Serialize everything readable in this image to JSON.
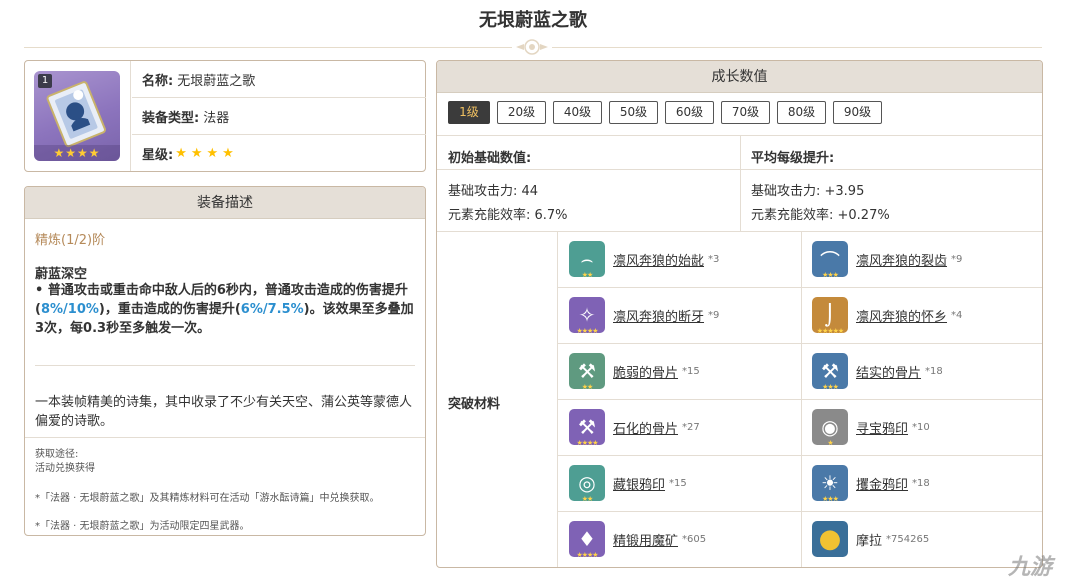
{
  "title": "无垠蔚蓝之歌",
  "info": {
    "level_badge": "1",
    "name_key": "名称:",
    "name_val": "无垠蔚蓝之歌",
    "type_key": "装备类型:",
    "type_val": "法器",
    "rarity_key": "星级:",
    "rarity_stars": "★★★★",
    "rarity": 4
  },
  "desc": {
    "header": "装备描述",
    "refine": "精炼(1/2)阶",
    "skill_name": "蔚蓝深空",
    "skill_text_1": "•  普通攻击或重击命中敌人后的6秒内，普通攻击造成的伤害提升(",
    "skill_num_1": "8%/10%",
    "skill_text_2": ")，重击造成的伤害提升(",
    "skill_num_2": "6%/7.5%",
    "skill_text_3": ")。该效果至多叠加3次，每0.3秒至多触发一次。",
    "flavor": "一本装帧精美的诗集，其中收录了不少有关天空、蒲公英等蒙德人偏爱的诗歌。",
    "source_title": "获取途径:",
    "source_value": "活动兑换获得",
    "note_1": "*「法器 · 无垠蔚蓝之歌」及其精炼材料可在活动「游水酝诗篇」中兑换获取。",
    "note_2": "*「法器 · 无垠蔚蓝之歌」为活动限定四星武器。"
  },
  "growth": {
    "header": "成长数值",
    "levels": [
      "1级",
      "20级",
      "40级",
      "50级",
      "60级",
      "70级",
      "80级",
      "90级"
    ],
    "active_level": "1级",
    "base_title": "初始基础数值:",
    "avg_title": "平均每级提升:",
    "base_atk": "基础攻击力: 44",
    "base_er": "元素充能效率: 6.7%",
    "avg_atk": "基础攻击力: +3.95",
    "avg_er": "元素充能效率: +0.27%",
    "materials_label": "突破材料",
    "materials": [
      {
        "name": "凛风奔狼的始龀",
        "count": "*3",
        "icon": "tooth-icon",
        "color": "#4e9e93",
        "stars": "★★"
      },
      {
        "name": "凛风奔狼的裂齿",
        "count": "*9",
        "icon": "fang-icon",
        "color": "#4a79a8",
        "stars": "★★★"
      },
      {
        "name": "凛风奔狼的断牙",
        "count": "*9",
        "icon": "broken-fang-icon",
        "color": "#7f62b5",
        "stars": "★★★★"
      },
      {
        "name": "凛风奔狼的怀乡",
        "count": "*4",
        "icon": "horn-icon",
        "color": "#c48a3b",
        "stars": "★★★★★"
      },
      {
        "name": "脆弱的骨片",
        "count": "*15",
        "icon": "bone-icon",
        "color": "#5f9a80",
        "stars": "★★"
      },
      {
        "name": "结实的骨片",
        "count": "*18",
        "icon": "bone-icon",
        "color": "#4a79a8",
        "stars": "★★★"
      },
      {
        "name": "石化的骨片",
        "count": "*27",
        "icon": "fossil-bone-icon",
        "color": "#7f62b5",
        "stars": "★★★★"
      },
      {
        "name": "寻宝鸦印",
        "count": "*10",
        "icon": "insignia-icon",
        "color": "#8a8a8a",
        "stars": "★"
      },
      {
        "name": "藏银鸦印",
        "count": "*15",
        "icon": "silver-insignia-icon",
        "color": "#4e9e93",
        "stars": "★★"
      },
      {
        "name": "攫金鸦印",
        "count": "*18",
        "icon": "gold-insignia-icon",
        "color": "#4a79a8",
        "stars": "★★★"
      },
      {
        "name": "精锻用魔矿",
        "count": "*605",
        "icon": "crystal-ore-icon",
        "color": "#7f62b5",
        "stars": "★★★★"
      },
      {
        "name": "摩拉",
        "count": "*754265",
        "icon": "mora-coin-icon",
        "color": "#3a6f99",
        "stars": ""
      }
    ]
  },
  "watermark": "九游"
}
